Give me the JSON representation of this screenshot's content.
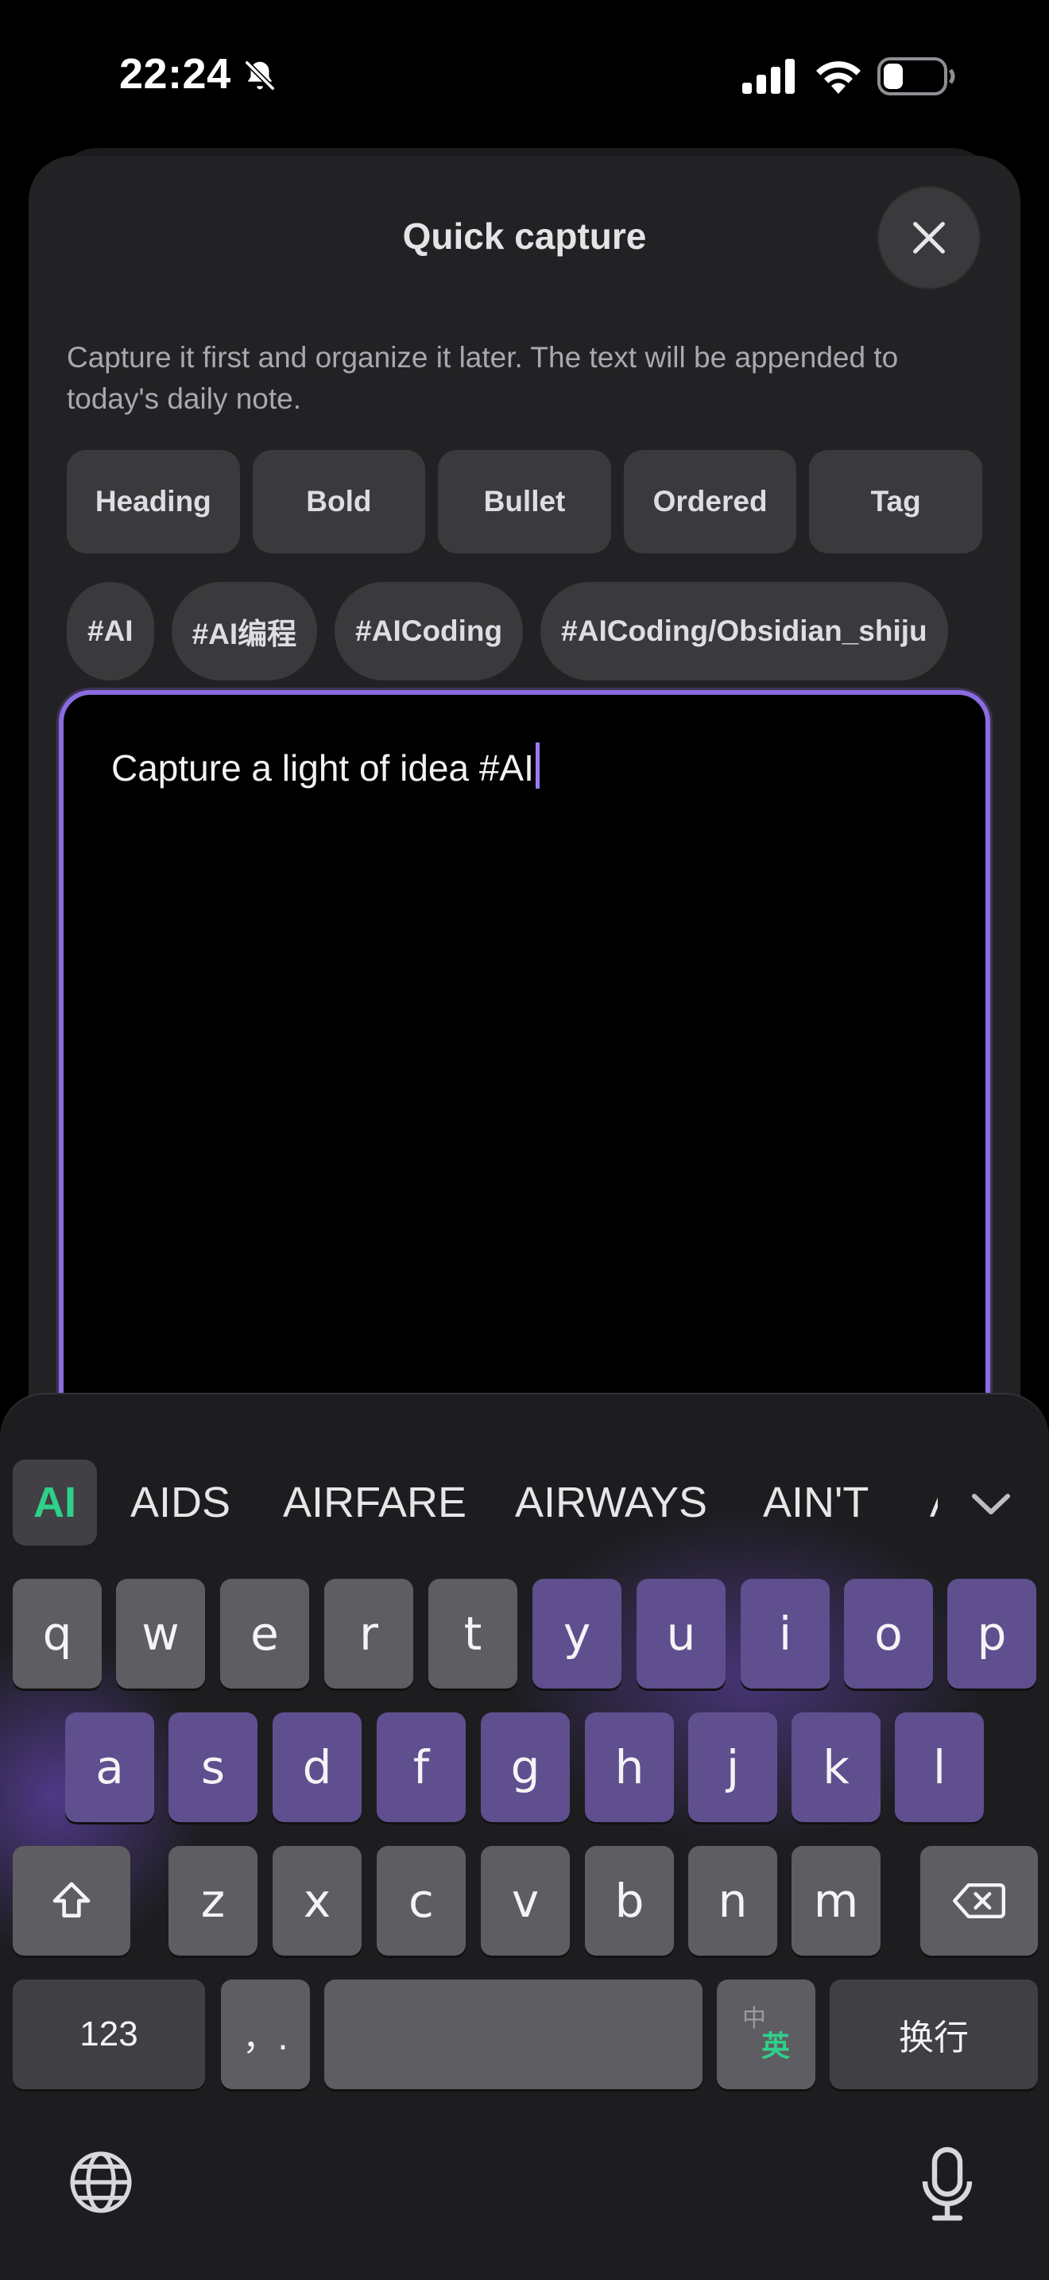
{
  "status_bar": {
    "time": "22:24"
  },
  "sheet": {
    "title": "Quick capture",
    "description": "Capture it first and organize it later. The text will be appended to today's daily note."
  },
  "format_buttons": [
    {
      "label": "Heading"
    },
    {
      "label": "Bold"
    },
    {
      "label": "Bullet"
    },
    {
      "label": "Ordered"
    },
    {
      "label": "Tag"
    }
  ],
  "tags": [
    {
      "label": "#AI"
    },
    {
      "label": "#AI编程"
    },
    {
      "label": "#AICoding"
    },
    {
      "label": "#AICoding/Obsidian_shiju"
    }
  ],
  "editor": {
    "text": "Capture a light of idea #AI"
  },
  "keyboard": {
    "suggestions": [
      "AI",
      "AIDS",
      "AIRFARE",
      "AIRWAYS",
      "AIN'T",
      "A"
    ],
    "row1": [
      "q",
      "w",
      "e",
      "r",
      "t",
      "y",
      "u",
      "i",
      "o",
      "p"
    ],
    "row2": [
      "a",
      "s",
      "d",
      "f",
      "g",
      "h",
      "j",
      "k",
      "l"
    ],
    "row3": [
      "z",
      "x",
      "c",
      "v",
      "b",
      "n",
      "m"
    ],
    "numbers_label": "123",
    "punct_label": "，.",
    "lang_top": "中",
    "lang_bottom": "英",
    "return_label": "换行",
    "accent_color": "#8a6ce0",
    "suggestion_active_color": "#2fd08a"
  }
}
